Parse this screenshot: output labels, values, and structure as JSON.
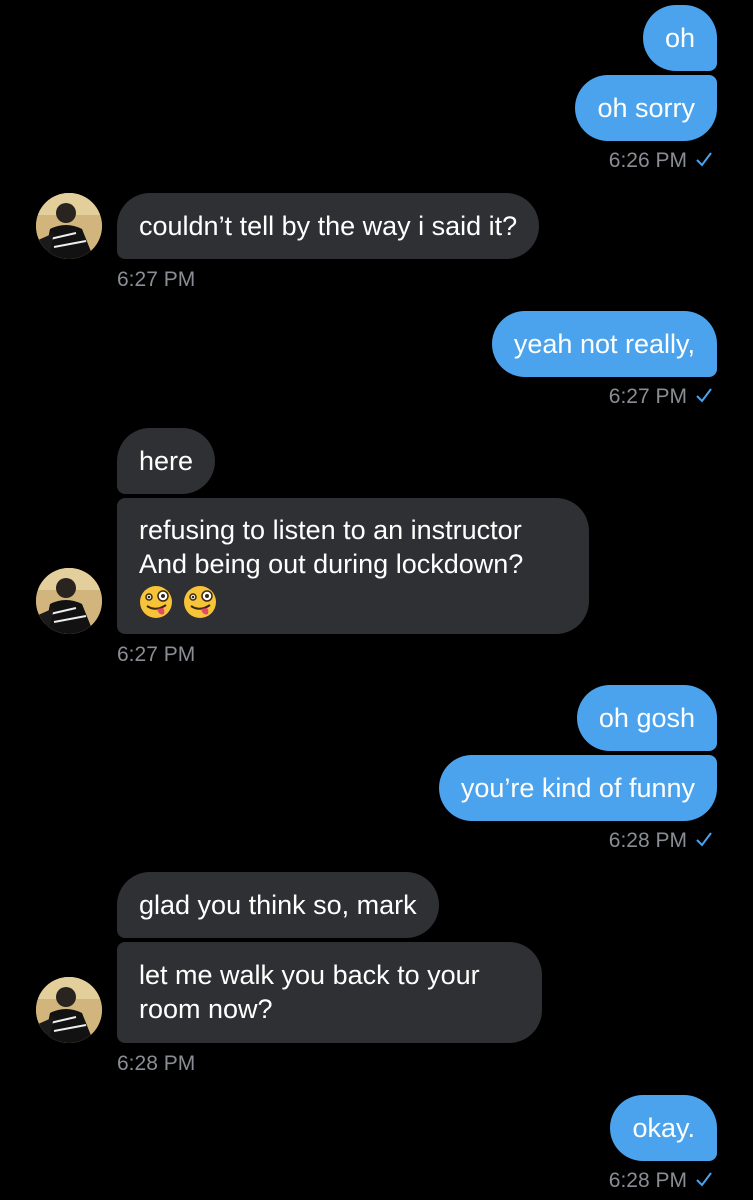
{
  "colors": {
    "background": "#000000",
    "sent_bubble": "#4aa3ec",
    "received_bubble": "#2f3033",
    "meta_text": "#8a8d93",
    "read_check": "#4aa3ec"
  },
  "messages": {
    "m1": "oh",
    "m2": "oh sorry",
    "t1": "6:26 PM",
    "m3": "couldn’t tell by the way i said it?",
    "t2": "6:27 PM",
    "m4": "yeah not really,",
    "t3": "6:27 PM",
    "m5": "here",
    "m6_line1": "refusing to listen to an instructor",
    "m6_line2": "And being out during lockdown?",
    "t4": "6:27 PM",
    "m7": "oh gosh",
    "m8": "you’re kind of funny",
    "t5": "6:28 PM",
    "m9": "glad you think so, mark",
    "m10_line1": "let me walk you back to your",
    "m10_line2": "room now?",
    "t6": "6:28 PM",
    "m11": "okay.",
    "t7": "6:28 PM"
  },
  "icons": {
    "read_receipt": "checkmark-icon",
    "avatar": "contact-avatar",
    "emoji": "zany-face-emoji"
  }
}
